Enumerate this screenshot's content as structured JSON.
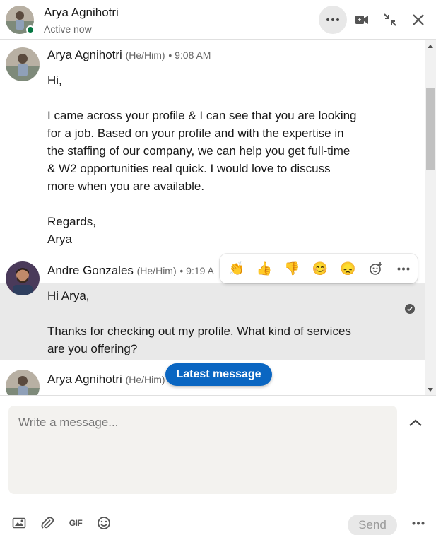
{
  "header": {
    "name": "Arya Agnihotri",
    "status": "Active now"
  },
  "messages": [
    {
      "sender": "Arya Agnihotri",
      "pronouns": "(He/Him)",
      "time": "• 9:08 AM",
      "lines": [
        "Hi,",
        "",
        "I came across your profile & I can see that you are looking",
        "for a job. Based on your profile and with the expertise in",
        "the staffing of our company, we can help you get full-time",
        "& W2 opportunities real quick. I would love to discuss",
        "more when you are available.",
        "",
        "Regards,",
        "Arya"
      ]
    },
    {
      "sender": "Andre Gonzales",
      "pronouns": "(He/Him)",
      "time": "• 9:19 A",
      "lines": [
        "Hi Arya,",
        "",
        "Thanks for checking out my profile. What kind of services",
        "are you offering?"
      ]
    },
    {
      "sender": "Arya Agnihotri",
      "pronouns": "(He/Him)"
    }
  ],
  "reactions": {
    "clap": "👏",
    "like": "👍",
    "dislike": "👎",
    "smile": "😊",
    "sad": "😞"
  },
  "latest_message_label": "Latest message",
  "composer": {
    "placeholder": "Write a message..."
  },
  "send_label": "Send",
  "toolbar": {
    "gif_label": "GIF"
  },
  "colors": {
    "accent": "#0a66c2",
    "presence": "#057642",
    "highlight": "#e9e9e9"
  }
}
